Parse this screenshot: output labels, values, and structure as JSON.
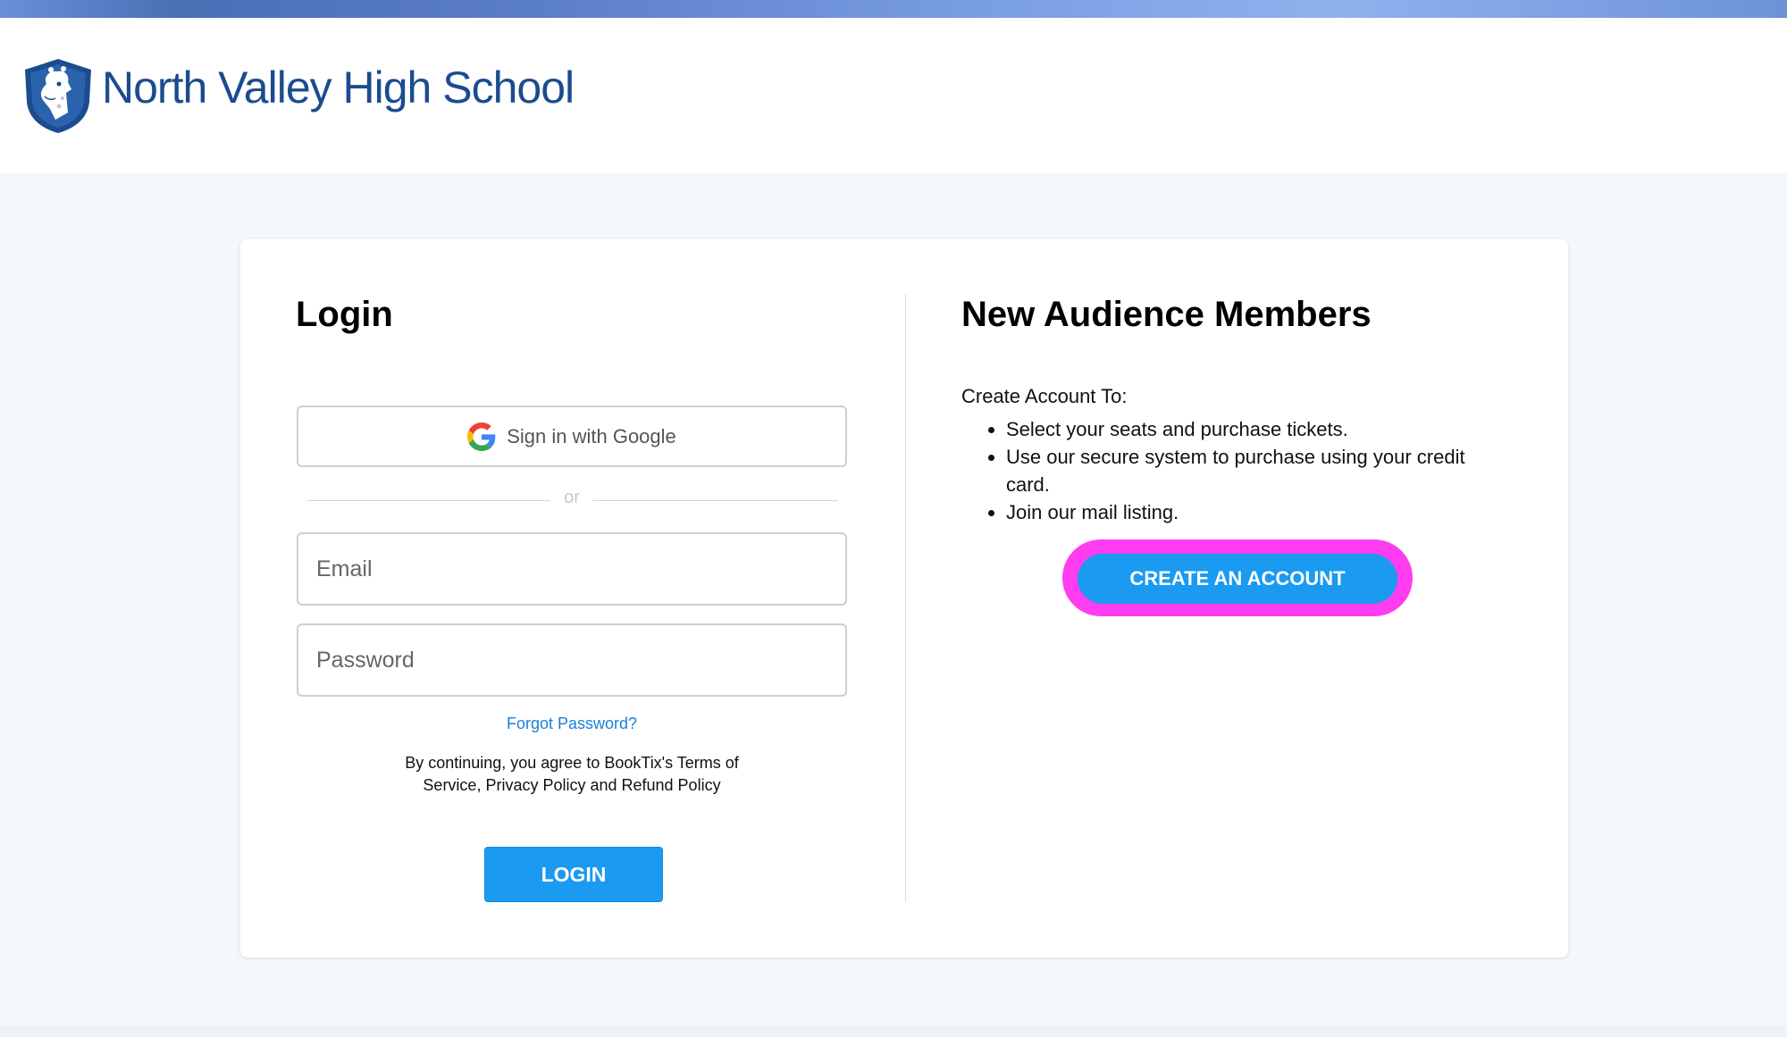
{
  "header": {
    "school_name": "North Valley High School",
    "logo_icon": "giraffe-shield-icon"
  },
  "login": {
    "title": "Login",
    "google_button_label": "Sign in with Google",
    "google_icon": "google-g-icon",
    "separator_text": "or",
    "email_placeholder": "Email",
    "email_value": "",
    "password_placeholder": "Password",
    "password_value": "",
    "forgot_password_label": "Forgot Password?",
    "terms_text": "By continuing, you agree to BookTix's Terms of Service, Privacy Policy and Refund Policy",
    "login_button_label": "LOGIN"
  },
  "new_members": {
    "title": "New Audience Members",
    "intro": "Create Account To:",
    "benefits": [
      "Select your seats and purchase tickets.",
      "Use our secure system to purchase using your credit card.",
      "Join our mail listing."
    ],
    "create_button_label": "CREATE AN ACCOUNT"
  },
  "colors": {
    "brand_blue": "#1b4c8f",
    "button_blue": "#1a9af0",
    "link_blue": "#1a80d9",
    "highlight_magenta": "#ff3cf0"
  }
}
